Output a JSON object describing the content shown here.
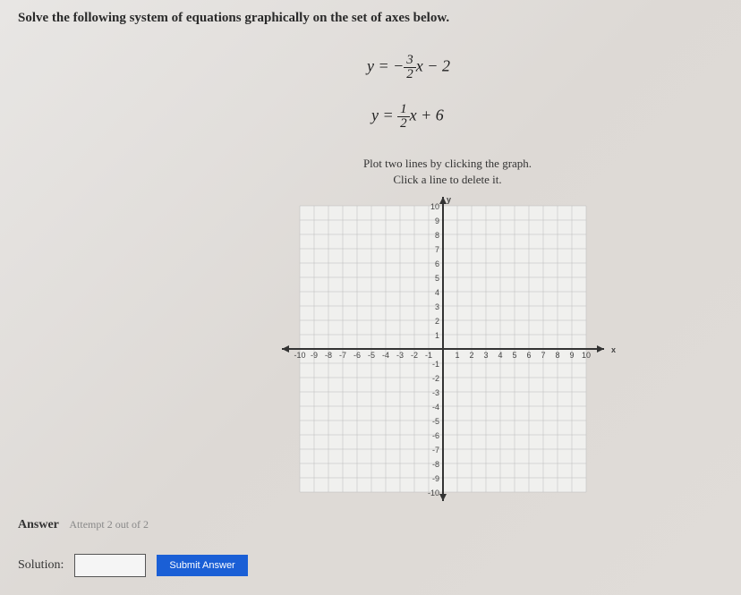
{
  "question": "Solve the following system of equations graphically on the set of axes below.",
  "eq1": {
    "lhs": "y = ",
    "neg": "−",
    "num": "3",
    "den": "2",
    "var": "x",
    "tail": " − 2"
  },
  "eq2": {
    "lhs": "y = ",
    "num": "1",
    "den": "2",
    "var": "x",
    "tail": " + 6"
  },
  "instruction_line1": "Plot two lines by clicking the graph.",
  "instruction_line2": "Click a line to delete it.",
  "answer_label": "Answer",
  "attempt_text": "Attempt 2 out of 2",
  "solution_label": "Solution:",
  "submit_label": "Submit Answer",
  "chart_data": {
    "type": "scatter",
    "title": "",
    "xlabel": "x",
    "ylabel": "y",
    "xlim": [
      -10,
      10
    ],
    "ylim": [
      -10,
      10
    ],
    "x_ticks": [
      -10,
      -9,
      -8,
      -7,
      -6,
      -5,
      -4,
      -3,
      -2,
      -1,
      1,
      2,
      3,
      4,
      5,
      6,
      7,
      8,
      9,
      10
    ],
    "y_ticks": [
      -10,
      -9,
      -8,
      -7,
      -6,
      -5,
      -4,
      -3,
      -2,
      -1,
      1,
      2,
      3,
      4,
      5,
      6,
      7,
      8,
      9,
      10
    ],
    "series": []
  }
}
